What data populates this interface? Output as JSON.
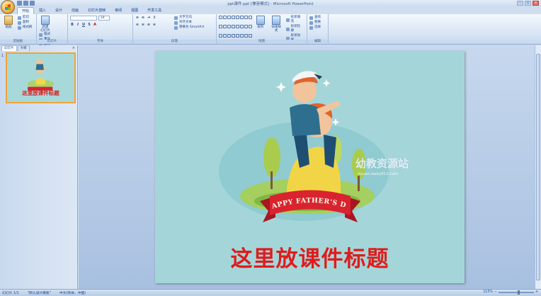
{
  "window": {
    "title": "ppt课件.ppt [兼容模式] - Microsoft PowerPoint"
  },
  "ribbon": {
    "tabs": [
      "开始",
      "插入",
      "设计",
      "动画",
      "幻灯片放映",
      "审阅",
      "视图",
      "开发工具"
    ],
    "active_tab": "开始",
    "clipboard": {
      "paste": "粘贴",
      "cut": "剪切",
      "copy": "复制",
      "painter": "格式刷",
      "label": "剪贴板"
    },
    "slides": {
      "new": "新建\n幻灯片",
      "layout": "版式",
      "reset": "重设",
      "delete": "删除",
      "label": "幻灯片"
    },
    "font": {
      "font_size": "18",
      "label": "字体"
    },
    "paragraph": {
      "text_direction": "文字方向",
      "align_text": "对齐文本",
      "smartart": "转换为 SmartArt",
      "label": "段落"
    },
    "drawing": {
      "arrange": "排列",
      "quick_styles": "快速样式",
      "fill": "形状填充",
      "outline": "形状轮廓",
      "effects": "形状效果",
      "label": "绘图"
    },
    "editing": {
      "find": "查找",
      "replace": "替换",
      "select": "选择",
      "label": "编辑"
    }
  },
  "left_pane": {
    "tab_slides": "幻灯片",
    "tab_outline": "大纲",
    "close": "×",
    "thumbnail_number": "1",
    "thumbnail_title": "这里放课件标题"
  },
  "slide": {
    "banner_text": "HAPPY FATHER'S DAY",
    "title": "这里放课件标题",
    "watermark": "幼教资源站",
    "watermark_url": "ziyuan.baby611.com"
  },
  "status": {
    "slide_pos": "幻灯片 1/1",
    "theme": "\"默认设计模板\"",
    "language": "中文(简体，中国)",
    "zoom": "115%"
  },
  "colors": {
    "slide_bg": "#a4d6d9",
    "title_red": "#e01b1b",
    "ribbon_red": "#c9202a",
    "thumb_border": "#f0a43a"
  }
}
